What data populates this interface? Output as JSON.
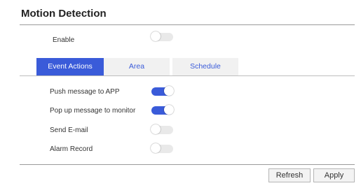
{
  "page": {
    "title": "Motion Detection"
  },
  "enable": {
    "label": "Enable",
    "state": "off"
  },
  "tabs": [
    {
      "label": "Event Actions",
      "active": true
    },
    {
      "label": "Area",
      "active": false
    },
    {
      "label": "Schedule",
      "active": false
    }
  ],
  "actions": [
    {
      "label": "Push message to APP",
      "state": "on"
    },
    {
      "label": "Pop up message to monitor",
      "state": "on"
    },
    {
      "label": "Send E-mail",
      "state": "off"
    },
    {
      "label": "Alarm Record",
      "state": "off"
    }
  ],
  "buttons": {
    "refresh": "Refresh",
    "apply": "Apply"
  },
  "colors": {
    "accent": "#3a5bd9",
    "toggle_off": "#e9e9e9",
    "tab_inactive_bg": "#f1f1f1"
  }
}
